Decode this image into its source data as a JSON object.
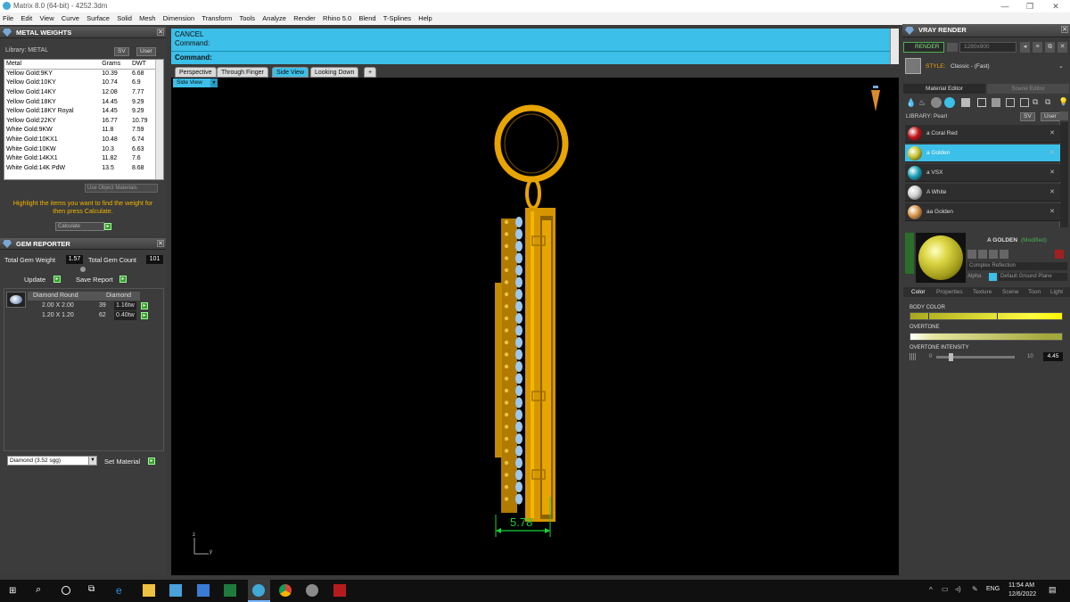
{
  "window": {
    "title": "Matrix 8.0 (64-bit) - 4252.3dm"
  },
  "menu": [
    "File",
    "Edit",
    "View",
    "Curve",
    "Surface",
    "Solid",
    "Mesh",
    "Dimension",
    "Transform",
    "Tools",
    "Analyze",
    "Render",
    "Rhino 5.0",
    "Blend",
    "T-Splines",
    "Help"
  ],
  "metal_weights": {
    "title": "METAL WEIGHTS",
    "library_label": "Library: METAL",
    "btn_sv": "SV",
    "btn_user": "User",
    "headers": [
      "Metal",
      "Grams",
      "DWT"
    ],
    "rows": [
      [
        "Yellow Gold:9KY",
        "10.39",
        "6.68"
      ],
      [
        "Yellow Gold:10KY",
        "10.74",
        "6.9"
      ],
      [
        "Yellow Gold:14KY",
        "12.08",
        "7.77"
      ],
      [
        "Yellow Gold:18KY",
        "14.45",
        "9.29"
      ],
      [
        "Yellow Gold:18KY Royal",
        "14.45",
        "9.29"
      ],
      [
        "Yellow Gold:22KY",
        "16.77",
        "10.79"
      ],
      [
        "White Gold:9KW",
        "11.8",
        "7.59"
      ],
      [
        "White Gold:10KX1",
        "10.48",
        "6.74"
      ],
      [
        "White Gold:10KW",
        "10.3",
        "6.63"
      ],
      [
        "White Gold:14KX1",
        "11.82",
        "7.6"
      ],
      [
        "White Gold:14K PdW",
        "13.5",
        "8.68"
      ]
    ],
    "use_object_materials": "Use Object Materials",
    "hint": "Highlight the items you want to find the weight for then press Calculate.",
    "calculate": "Calculate"
  },
  "gem_reporter": {
    "title": "GEM REPORTER",
    "total_weight_label": "Total Gem Weight",
    "total_weight": "1.57",
    "total_count_label": "Total Gem Count",
    "total_count": "101",
    "update": "Update",
    "save_report": "Save Report",
    "headers": [
      "Diamond Round",
      "Diamond"
    ],
    "rows": [
      [
        "2.00 X 2.00",
        "39",
        "1.16tw"
      ],
      [
        "1.20 X 1.20",
        "62",
        "0.40tw"
      ]
    ],
    "material_select": "Diamond    (3.52 sgg)",
    "set_material": "Set Material"
  },
  "command": {
    "line1": "CANCEL",
    "line2": "Command:",
    "prompt": "Command:"
  },
  "view_tabs": [
    "Perspective",
    "Through Finger",
    "Side View",
    "Looking Down"
  ],
  "active_view_label": "Side View",
  "dimension_value": "5.78",
  "axis_labels": {
    "z": "z",
    "y": "y"
  },
  "vray": {
    "title": "VRAY RENDER",
    "render": "RENDER",
    "resolution": "1280x900",
    "style_label": "STYLE:",
    "style_value": "Classic - (Fast)",
    "tab_material_editor": "Material Editor",
    "tab_scene_editor": "Scene Editor",
    "library_label": "LIBRARY: Pearl",
    "btn_sv": "SV",
    "btn_user": "User",
    "materials": [
      {
        "name": "a Coral Red",
        "color": "#c0151a"
      },
      {
        "name": "a Golden",
        "color": "#c9c22e"
      },
      {
        "name": "a VSX",
        "color": "#1aa3b5"
      },
      {
        "name": "A White",
        "color": "#cfcfcf"
      },
      {
        "name": "aa Golden",
        "color": "#d9944a"
      }
    ],
    "preview_name": "A GOLDEN",
    "preview_modified": "(Modified)",
    "complex_reflection": "Complex Reflection",
    "alpha_label": "Alpha",
    "ground_plane": "Default Ground Plane",
    "sub_tabs": [
      "Color",
      "Properties",
      "Texture",
      "Scene",
      "Toon",
      "Light"
    ],
    "body_color_label": "BODY COLOR",
    "overtone_label": "OVERTONE",
    "overtone_intensity_label": "OVERTONE INTENSITY",
    "intensity_min": "0",
    "intensity_max": "10",
    "intensity_value": "4.45"
  },
  "taskbar": {
    "time": "11:54 AM",
    "date": "12/6/2022",
    "lang": "ENG"
  }
}
